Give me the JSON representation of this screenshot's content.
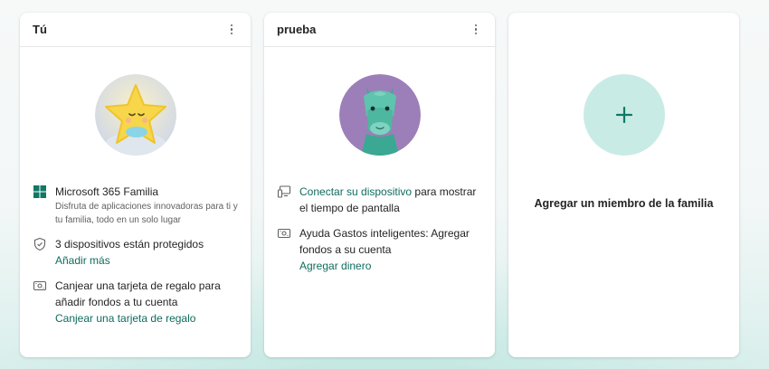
{
  "colors": {
    "accent_link": "#0f6c5e",
    "add_circle": "#c9ebe6",
    "plus": "#117865"
  },
  "cards": [
    {
      "title": "Tú",
      "avatar_icon": "star-avatar",
      "items": [
        {
          "icon": "microsoft-365-icon",
          "title": "Microsoft 365 Familia",
          "subtitle": "Disfruta de aplicaciones innovadoras para ti y tu familia, todo en un solo lugar"
        },
        {
          "icon": "shield-icon",
          "text": "3 dispositivos están protegidos",
          "link": "Añadir más"
        },
        {
          "icon": "gift-card-icon",
          "text": "Canjear una tarjeta de regalo para añadir fondos a tu cuenta",
          "link": "Canjear una tarjeta de regalo"
        }
      ]
    },
    {
      "title": "prueba",
      "avatar_icon": "llama-avatar",
      "items": [
        {
          "icon": "devices-icon",
          "link": "Conectar su dispositivo",
          "text": " para mostrar el tiempo de pantalla"
        },
        {
          "icon": "money-icon",
          "text": "Ayuda Gastos inteligentes: Agregar fondos a su cuenta",
          "link": "Agregar dinero"
        }
      ]
    },
    {
      "label": "Agregar un miembro de la familia",
      "icon": "plus-icon"
    }
  ]
}
